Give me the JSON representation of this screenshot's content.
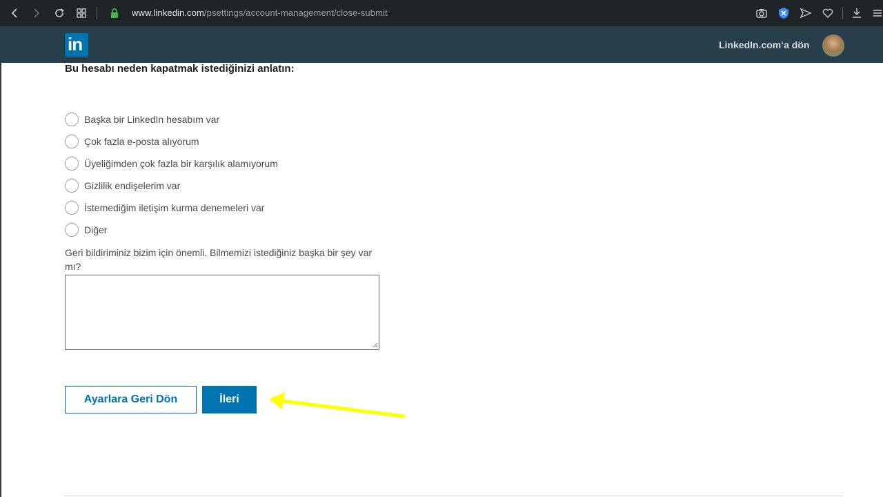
{
  "browser": {
    "url_host": "www.linkedin.com",
    "url_path": "/psettings/account-management/close-submit"
  },
  "header": {
    "logo_text": "in",
    "back_link": "LinkedIn.com‘a dön"
  },
  "form": {
    "title": "Bu hesabı neden kapatmak istediğinizi anlatın:",
    "reasons": [
      "Başka bir LinkedIn hesabım var",
      "Çok fazla e-posta alıyorum",
      "Üyeliğimden çok fazla bir karşılık alamıyorum",
      "Gizlilik endişelerim var",
      "İstemediğim iletişim kurma denemeleri var",
      "Diğer"
    ],
    "feedback_label": "Geri bildiriminiz bizim için önemli. Bilmemizi istediğiniz başka bir şey var mı?",
    "feedback_value": "",
    "back_button": "Ayarlara Geri Dön",
    "next_button": "İleri"
  },
  "colors": {
    "brand_blue": "#0073b1",
    "header_bg": "#283e4a",
    "annotation_arrow": "#ffff00"
  }
}
